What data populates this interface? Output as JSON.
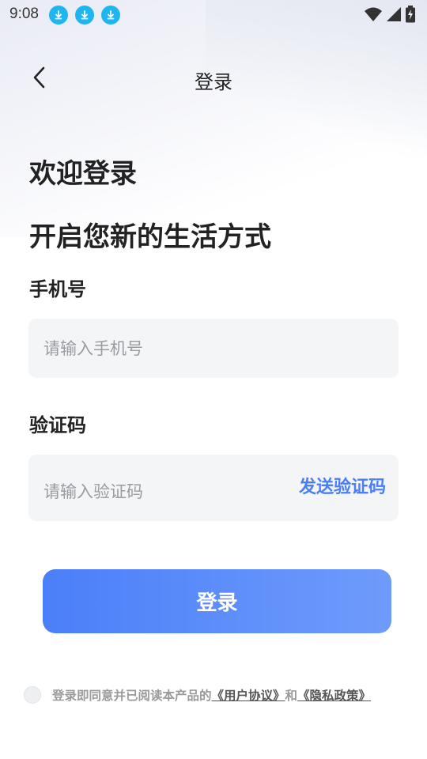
{
  "status_bar": {
    "time": "9:08",
    "notification_icons": [
      "download-icon",
      "download-icon",
      "download-icon"
    ],
    "system_icons": [
      "wifi-icon",
      "signal-icon",
      "battery-charging-icon"
    ]
  },
  "header": {
    "title": "登录",
    "back_icon": "chevron-left-icon"
  },
  "welcome": {
    "title": "欢迎登录",
    "subtitle": "开启您新的生活方式"
  },
  "form": {
    "phone": {
      "label": "手机号",
      "placeholder": "请输入手机号",
      "value": ""
    },
    "code": {
      "label": "验证码",
      "placeholder": "请输入验证码",
      "value": "",
      "send_label": "发送验证码"
    },
    "submit_label": "登录"
  },
  "agreement": {
    "checked": false,
    "prefix": "登录即同意并已阅读本产品的",
    "user_agreement": "《用户协议》",
    "conjunction": "和",
    "privacy_policy": "《隐私政策》"
  },
  "colors": {
    "accent": "#4b7ef4",
    "button_start": "#4b7ff9",
    "button_end": "#6e9bfb",
    "input_bg": "#f4f5f7",
    "notify_icon_bg": "#1fb5f0"
  }
}
